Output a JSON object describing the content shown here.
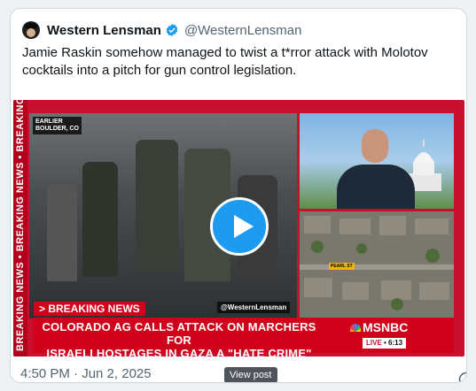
{
  "tweet": {
    "display_name": "Western Lensman",
    "handle": "@WesternLensman",
    "text": "Jamie Raskin somehow managed to twist a t*rror attack with Molotov cocktails into a pitch for gun control legislation.",
    "timestamp": "4:50 PM · Jun 2, 2025",
    "verified_icon": "verified-badge-icon",
    "info_icon": "info-icon"
  },
  "video": {
    "side_ticker": "BREAKING NEWS • BREAKING NEWS • BREAKING NEWS • BREAKING NEWS • BREAKING NEWS • BREAKING NEWS • NEWS",
    "earlier_label": "EARLIER",
    "location_label": "BOULDER, CO",
    "breaking_tag": "> BREAKING NEWS",
    "watermark": "@WesternLensman",
    "headline_line1": "COLORADO AG CALLS ATTACK ON MARCHERS FOR",
    "headline_line2": "ISRAELI HOSTAGES IN GAZA A \"HATE CRIME\"",
    "network": "MSNBC",
    "live_label": "LIVE",
    "live_time": "6:13",
    "map_label": "PEARL ST",
    "play_icon": "play-icon"
  },
  "tooltip": {
    "text": "View post"
  },
  "colors": {
    "accent": "#1d9bf0",
    "breaking_red": "#d0021b"
  }
}
